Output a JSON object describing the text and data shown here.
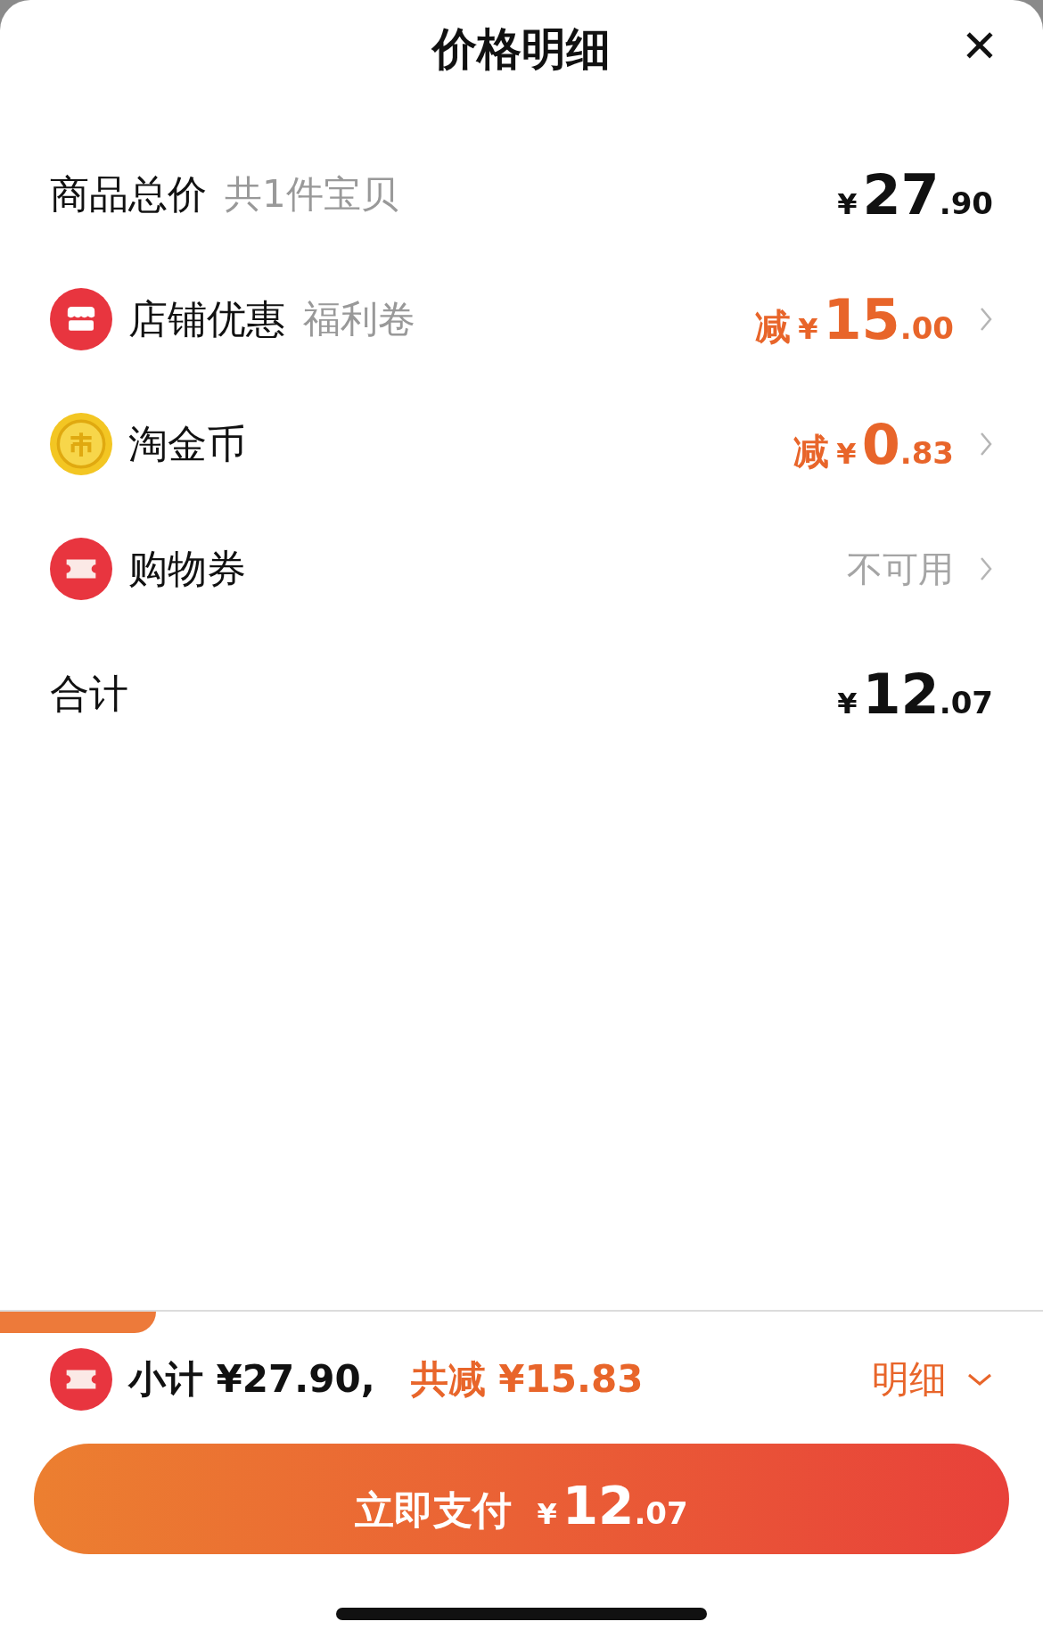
{
  "sheet": {
    "title": "价格明细",
    "close": "✕"
  },
  "rows": [
    {
      "kind": "total",
      "label": "商品总价",
      "note": "共1件宝贝",
      "currency": "¥",
      "integer": "27",
      "decimal": ".90"
    },
    {
      "kind": "discount",
      "label": "店铺优惠",
      "note": "福利卷",
      "prefix": "减",
      "currency": "¥",
      "integer": "15",
      "decimal": ".00"
    },
    {
      "kind": "discount",
      "label": "淘金币",
      "prefix": "减",
      "currency": "¥",
      "integer": "0",
      "decimal": ".83"
    },
    {
      "kind": "status",
      "label": "购物券",
      "status": "不可用"
    },
    {
      "kind": "total",
      "label": "合计",
      "currency": "¥",
      "integer": "12",
      "decimal": ".07"
    }
  ],
  "summary": {
    "subtotal": "小计 ¥27.90,",
    "saved": "共减 ¥15.83",
    "detail": "明细",
    "expanded": false
  },
  "pay_button": {
    "label": "立即支付",
    "currency": "¥",
    "integer": "12",
    "decimal": ".07"
  }
}
